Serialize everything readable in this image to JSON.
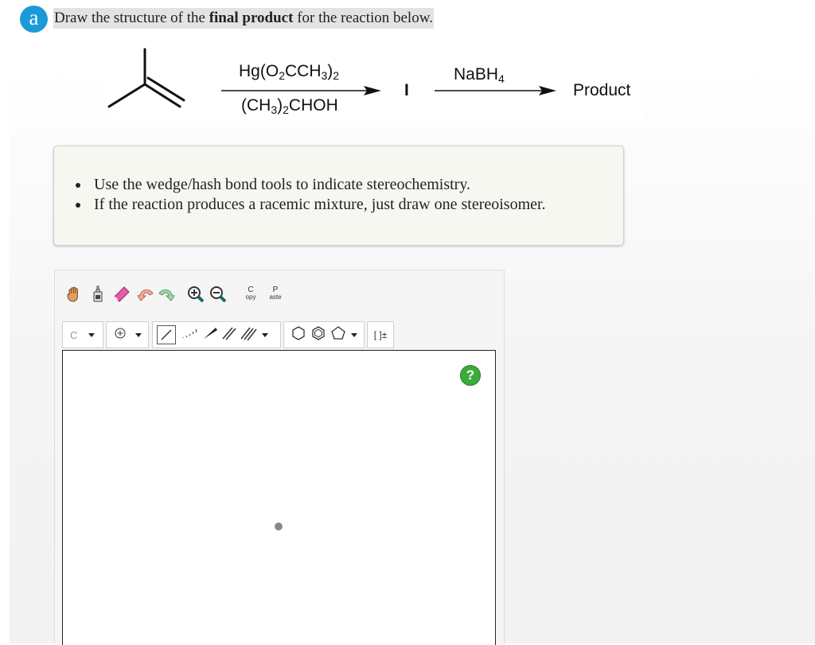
{
  "question": {
    "badge": "a",
    "text_before": "Draw the structure of the ",
    "text_bold": "final product",
    "text_after": " for the reaction below."
  },
  "reaction": {
    "reagent1_top": [
      "Hg(O",
      "2",
      "CCH",
      "3",
      ")",
      "2"
    ],
    "reagent1_bottom": [
      "(CH",
      "3",
      ")",
      "2",
      "CHOH"
    ],
    "intermediate": "I",
    "reagent2": [
      "NaBH",
      "4"
    ],
    "product": "Product"
  },
  "instructions": [
    "Use the wedge/hash bond tools to indicate stereochemistry.",
    "If the reaction produces a racemic mixture, just draw one stereoisomer."
  ],
  "toolbar": {
    "copy_label_top": "C",
    "copy_label_bottom": "opy",
    "paste_label_top": "P",
    "paste_label_bottom": "aste",
    "atom_label": "C",
    "bracket_label": "[ ]±"
  },
  "canvas": {
    "help_label": "?"
  },
  "colors": {
    "badge": "#1a9bd8",
    "help": "#3cab3c"
  }
}
